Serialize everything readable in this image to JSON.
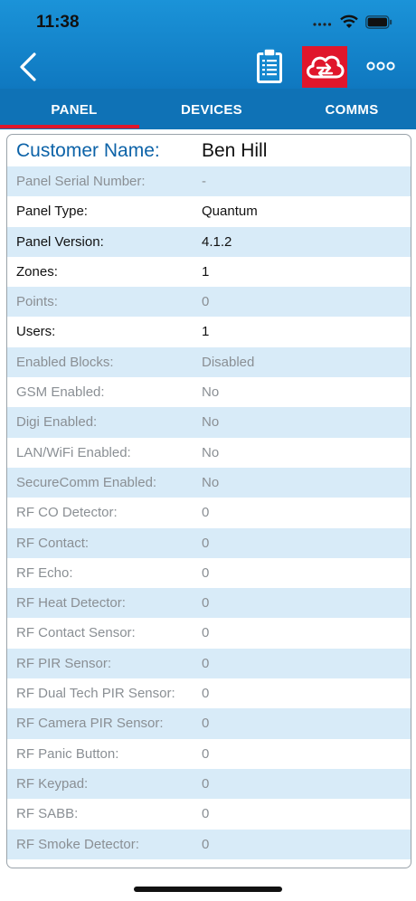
{
  "status_bar": {
    "time": "11:38"
  },
  "tabs": [
    {
      "label": "PANEL",
      "active": true
    },
    {
      "label": "DEVICES",
      "active": false
    },
    {
      "label": "COMMS",
      "active": false
    }
  ],
  "colors": {
    "header_blue": "#1b93d8",
    "tab_blue": "#0f72b6",
    "accent_red": "#e0162b",
    "row_alt": "#d8ebf8",
    "customer_label": "#0d63a8"
  },
  "icons": {
    "back": "back-chevron-icon",
    "clipboard": "clipboard-list-icon",
    "cloud": "cloud-sync-icon",
    "more": "more-options-icon"
  },
  "customer": {
    "label": "Customer Name:",
    "value": "Ben Hill"
  },
  "rows": [
    {
      "label": "Panel Serial Number:",
      "value": "-"
    },
    {
      "label": "Panel Type:",
      "value": "Quantum"
    },
    {
      "label": "Panel Version:",
      "value": "4.1.2"
    },
    {
      "label": "Zones:",
      "value": "1"
    },
    {
      "label": "Points:",
      "value": "0"
    },
    {
      "label": "Users:",
      "value": "1"
    },
    {
      "label": "Enabled Blocks:",
      "value": "Disabled"
    },
    {
      "label": "GSM Enabled:",
      "value": "No"
    },
    {
      "label": "Digi Enabled:",
      "value": "No"
    },
    {
      "label": "LAN/WiFi Enabled:",
      "value": "No"
    },
    {
      "label": "SecureComm Enabled:",
      "value": "No"
    },
    {
      "label": "RF CO Detector:",
      "value": "0"
    },
    {
      "label": "RF Contact:",
      "value": "0"
    },
    {
      "label": "RF Echo:",
      "value": "0"
    },
    {
      "label": "RF Heat Detector:",
      "value": "0"
    },
    {
      "label": "RF Contact Sensor:",
      "value": "0"
    },
    {
      "label": "RF PIR Sensor:",
      "value": "0"
    },
    {
      "label": "RF Dual Tech PIR Sensor:",
      "value": "0"
    },
    {
      "label": "RF Camera PIR Sensor:",
      "value": "0"
    },
    {
      "label": "RF Panic Button:",
      "value": "0"
    },
    {
      "label": "RF Keypad:",
      "value": "0"
    },
    {
      "label": "RF SABB:",
      "value": "0"
    },
    {
      "label": "RF Smoke Detector:",
      "value": "0"
    }
  ]
}
